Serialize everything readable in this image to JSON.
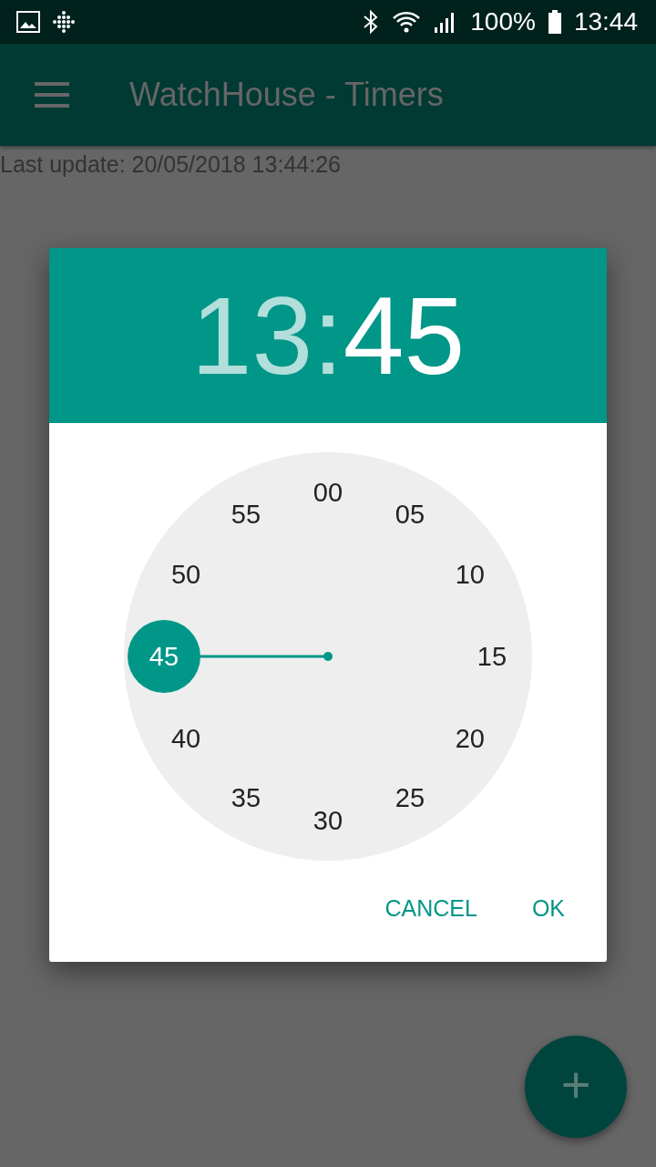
{
  "status_bar": {
    "battery": "100%",
    "time": "13:44"
  },
  "app_bar": {
    "title": "WatchHouse - Timers"
  },
  "last_update": "Last update: 20/05/2018 13:44:26",
  "dialog": {
    "hours": {
      "text": "13",
      "selected": false
    },
    "separator": ":",
    "minutes": {
      "text": "45",
      "selected": true
    },
    "dial": [
      {
        "label": "00",
        "selected": false
      },
      {
        "label": "05",
        "selected": false
      },
      {
        "label": "10",
        "selected": false
      },
      {
        "label": "15",
        "selected": false
      },
      {
        "label": "20",
        "selected": false
      },
      {
        "label": "25",
        "selected": false
      },
      {
        "label": "30",
        "selected": false
      },
      {
        "label": "35",
        "selected": false
      },
      {
        "label": "40",
        "selected": false
      },
      {
        "label": "45",
        "selected": true
      },
      {
        "label": "50",
        "selected": false
      },
      {
        "label": "55",
        "selected": false
      }
    ],
    "buttons": [
      "CANCEL",
      "OK"
    ]
  },
  "fab": {
    "label": "+"
  }
}
